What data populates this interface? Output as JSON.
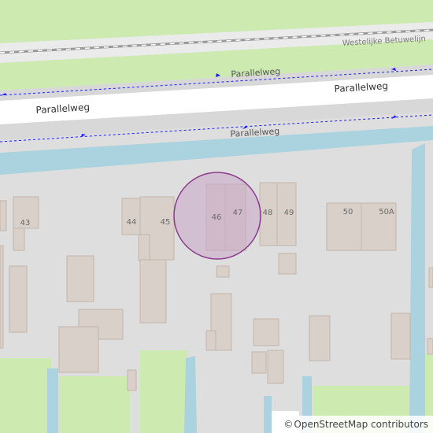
{
  "map": {
    "streets": {
      "railway": "Westelijke Betuwelijn",
      "road_top": "Parallelweg",
      "road_main": "Parallelweg",
      "road_bottom": "Parallelweg"
    },
    "house_numbers": [
      "43",
      "44",
      "45",
      "46",
      "47",
      "48",
      "49",
      "50",
      "50A"
    ],
    "attribution": {
      "symbol": "©",
      "text": "OpenStreetMap contributors"
    },
    "colors": {
      "grass": "#cdebb0",
      "water": "#aad3df",
      "road": "#ffffff",
      "residential": "#dedede",
      "building": "#d9d0c9",
      "building_outline": "#c4b6ab",
      "marker_fill": "#c8a5c8",
      "marker_stroke": "#8b3a8b",
      "path_dashed": "#1a1aff"
    }
  }
}
